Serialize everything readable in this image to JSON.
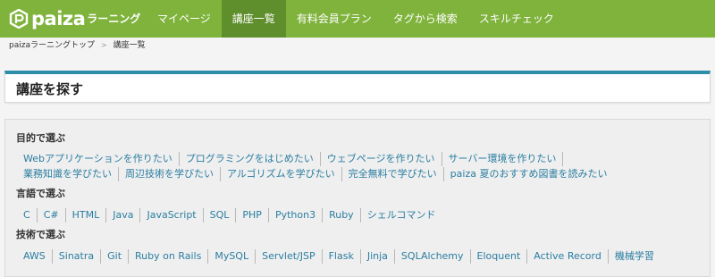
{
  "header": {
    "logo_text": "paiza",
    "logo_sub": "ラーニング",
    "nav": [
      {
        "label": "マイページ",
        "active": false
      },
      {
        "label": "講座一覧",
        "active": true
      },
      {
        "label": "有料会員プラン",
        "active": false
      },
      {
        "label": "タグから検索",
        "active": false
      },
      {
        "label": "スキルチェック",
        "active": false
      }
    ]
  },
  "breadcrumb": {
    "home": "paizaラーニングトップ",
    "separator": ">",
    "current": "講座一覧"
  },
  "page_title": "講座を探す",
  "sections": {
    "purpose": {
      "label": "目的で選ぶ",
      "rows": [
        [
          "Webアプリケーションを作りたい",
          "プログラミングをはじめたい",
          "ウェブページを作りたい",
          "サーバー環境を作りたい"
        ],
        [
          "業務知識を学びたい",
          "周辺技術を学びたい",
          "アルゴリズムを学びたい",
          "完全無料で学びたい",
          "paiza 夏のおすすめ図書を読みたい"
        ]
      ]
    },
    "language": {
      "label": "言語で選ぶ",
      "items": [
        "C",
        "C#",
        "HTML",
        "Java",
        "JavaScript",
        "SQL",
        "PHP",
        "Python3",
        "Ruby",
        "シェルコマンド"
      ]
    },
    "tech": {
      "label": "技術で選ぶ",
      "items": [
        "AWS",
        "Sinatra",
        "Git",
        "Ruby on Rails",
        "MySQL",
        "Servlet/JSP",
        "Flask",
        "Jinja",
        "SQLAlchemy",
        "Eloquent",
        "Active Record",
        "機械学習"
      ]
    }
  },
  "colors": {
    "header_green": "#7fb33c",
    "active_tab": "#5f8f2c",
    "accent_blue": "#2d8ea9",
    "link_blue": "#2a7ea1"
  }
}
